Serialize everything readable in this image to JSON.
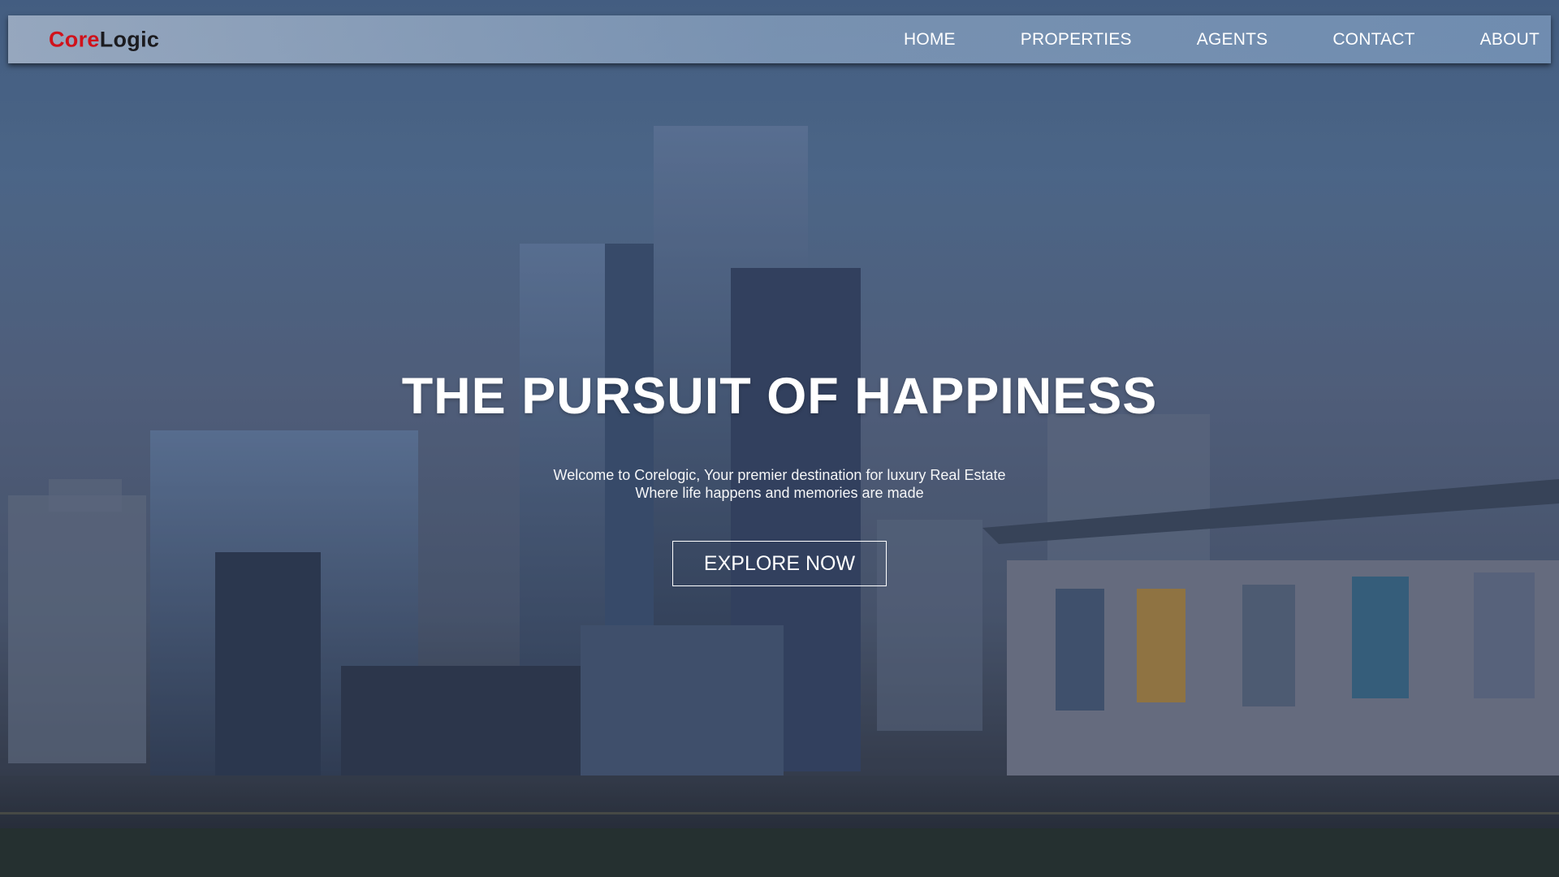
{
  "brand": {
    "part1": "Core",
    "part2": "Logic"
  },
  "nav": {
    "items": [
      "HOME",
      "PROPERTIES",
      "AGENTS",
      "CONTACT",
      "ABOUT"
    ]
  },
  "hero": {
    "title": "THE PURSUIT OF HAPPINESS",
    "subtitle_line1": "Welcome to Corelogic, Your premier destination for luxury Real Estate",
    "subtitle_line2": "Where life happens and memories are made",
    "cta_label": "EXPLORE NOW"
  },
  "colors": {
    "brand_accent": "#d0121b",
    "brand_dark": "#1b1b1f",
    "nav_text": "#ffffff"
  }
}
